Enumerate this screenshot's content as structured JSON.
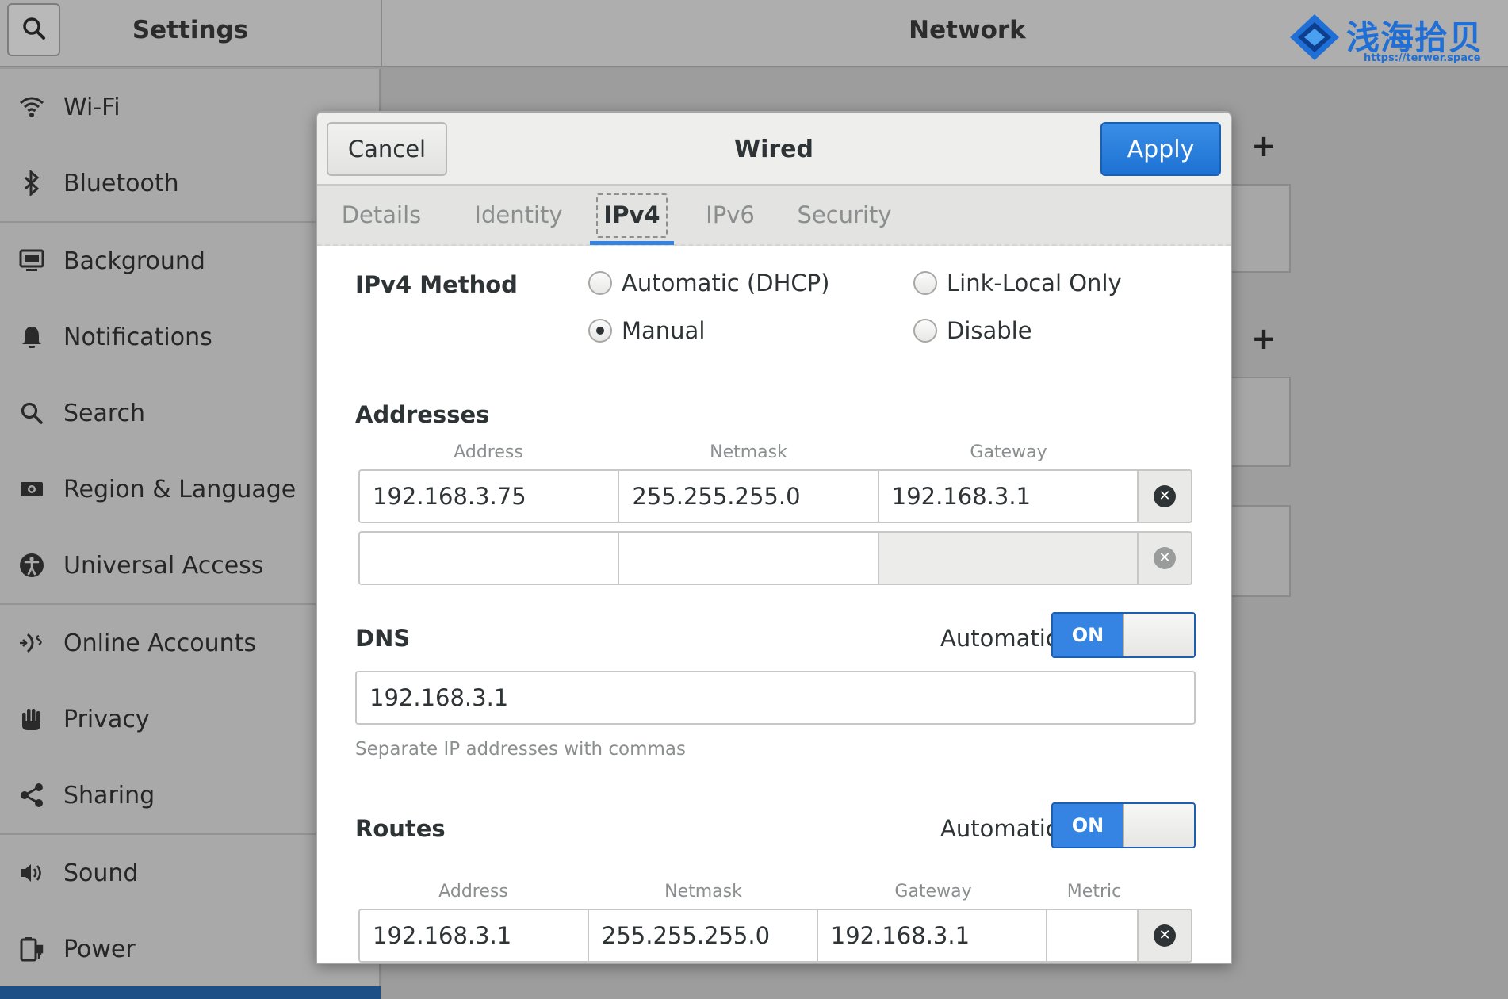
{
  "window": {
    "settings_title": "Settings",
    "panel_title": "Network"
  },
  "watermark": {
    "text": "浅海拾贝",
    "url": "https://terwer.space"
  },
  "sidebar": {
    "items": [
      {
        "label": "Wi-Fi",
        "icon": "wifi-icon"
      },
      {
        "label": "Bluetooth",
        "icon": "bluetooth-icon"
      },
      {
        "label": "Background",
        "icon": "background-icon"
      },
      {
        "label": "Notifications",
        "icon": "bell-icon"
      },
      {
        "label": "Search",
        "icon": "search-icon"
      },
      {
        "label": "Region & Language",
        "icon": "region-icon"
      },
      {
        "label": "Universal Access",
        "icon": "accessibility-icon"
      },
      {
        "label": "Online Accounts",
        "icon": "online-accounts-icon"
      },
      {
        "label": "Privacy",
        "icon": "hand-icon"
      },
      {
        "label": "Sharing",
        "icon": "share-icon"
      },
      {
        "label": "Sound",
        "icon": "speaker-icon"
      },
      {
        "label": "Power",
        "icon": "power-icon"
      }
    ]
  },
  "dialog": {
    "title": "Wired",
    "cancel_label": "Cancel",
    "apply_label": "Apply",
    "tabs": [
      {
        "label": "Details"
      },
      {
        "label": "Identity"
      },
      {
        "label": "IPv4",
        "active": true
      },
      {
        "label": "IPv6"
      },
      {
        "label": "Security"
      }
    ],
    "ipv4_method": {
      "label": "IPv4 Method",
      "options": [
        {
          "label": "Automatic (DHCP)",
          "checked": false
        },
        {
          "label": "Link-Local Only",
          "checked": false
        },
        {
          "label": "Manual",
          "checked": true
        },
        {
          "label": "Disable",
          "checked": false
        }
      ]
    },
    "addresses": {
      "label": "Addresses",
      "headers": [
        "Address",
        "Netmask",
        "Gateway"
      ],
      "rows": [
        {
          "address": "192.168.3.75",
          "netmask": "255.255.255.0",
          "gateway": "192.168.3.1"
        },
        {
          "address": "",
          "netmask": "",
          "gateway": ""
        }
      ]
    },
    "dns": {
      "label": "DNS",
      "automatic_label": "Automatic",
      "toggle_label": "ON",
      "value": "192.168.3.1",
      "hint": "Separate IP addresses with commas"
    },
    "routes": {
      "label": "Routes",
      "automatic_label": "Automatic",
      "toggle_label": "ON",
      "headers": [
        "Address",
        "Netmask",
        "Gateway",
        "Metric"
      ],
      "rows": [
        {
          "address": "192.168.3.1",
          "netmask": "255.255.255.0",
          "gateway": "192.168.3.1",
          "metric": ""
        }
      ]
    }
  },
  "colors": {
    "accent": "#3584e4",
    "apply_button": "#1d72d3",
    "selected_sidebar": "#1b4f86",
    "watermark": "#1f6fd6"
  }
}
